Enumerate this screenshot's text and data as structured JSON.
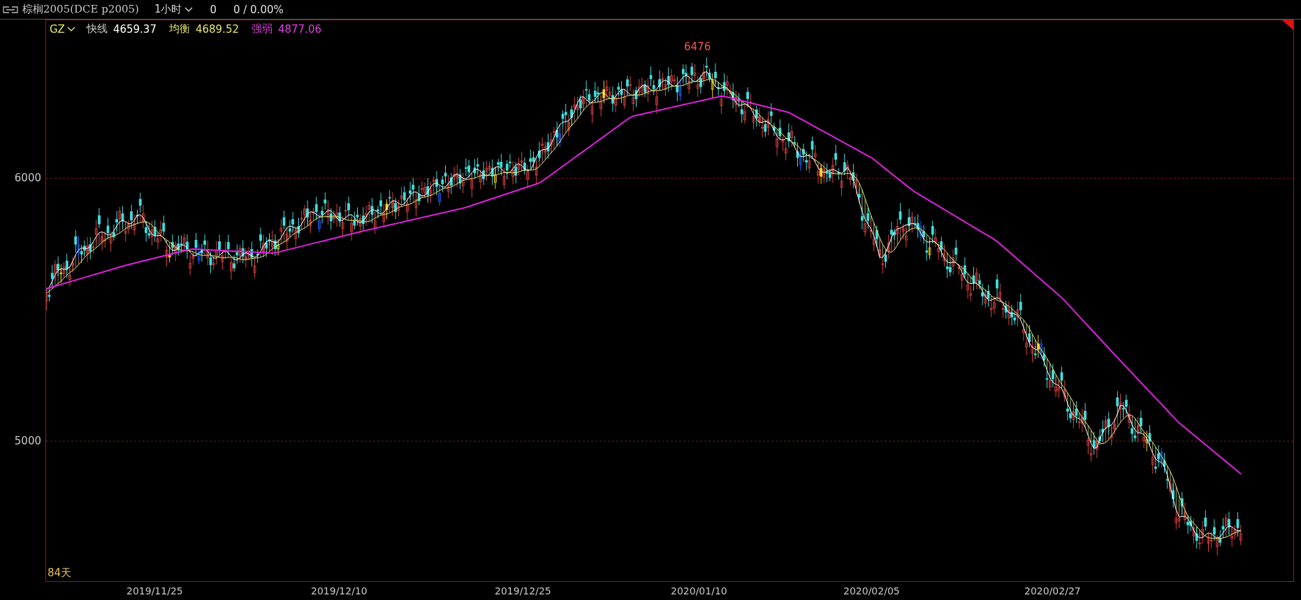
{
  "header": {
    "title": "棕榈2005(DCE p2005)",
    "period": "1小时",
    "change": "0",
    "change_pct": "0 / 0.00%"
  },
  "indicator": {
    "name": "GZ",
    "lines": [
      {
        "label": "快线",
        "value": "4659.37",
        "color": "#ffffff"
      },
      {
        "label": "均衡",
        "value": "4689.52",
        "color": "#e6e66a"
      },
      {
        "label": "强弱",
        "value": "4877.06",
        "color": "#e040e0"
      }
    ]
  },
  "chart": {
    "high_label": "6476",
    "span": "84天",
    "y_axis": [
      "6000",
      "5000"
    ],
    "x_axis": [
      "2019/11/25",
      "2019/12/10",
      "2019/12/25",
      "2020/01/10",
      "2020/02/05",
      "2020/02/27"
    ]
  }
}
